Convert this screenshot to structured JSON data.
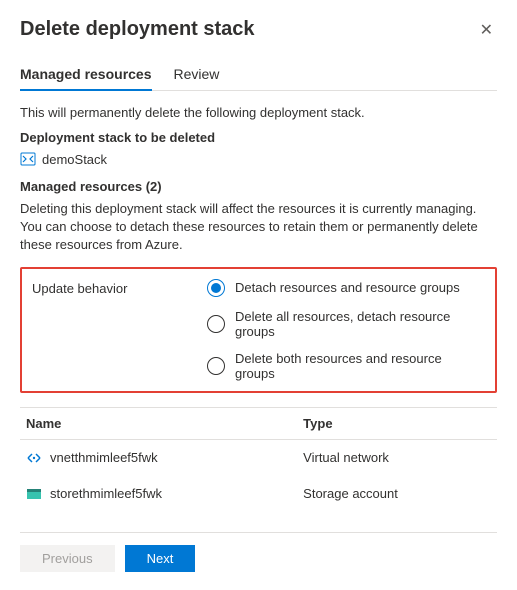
{
  "header": {
    "title": "Delete deployment stack"
  },
  "tabs": [
    {
      "label": "Managed resources",
      "active": true
    },
    {
      "label": "Review",
      "active": false
    }
  ],
  "intro_text": "This will permanently delete the following deployment stack.",
  "stack_section_label": "Deployment stack to be deleted",
  "stack_name": "demoStack",
  "managed_label": "Managed resources (2)",
  "managed_info": "Deleting this deployment stack will affect the resources it is currently managing. You can choose to detach these resources to retain them or permanently delete these resources from Azure.",
  "update_behavior": {
    "label": "Update behavior",
    "options": [
      {
        "label": "Detach resources and resource groups",
        "selected": true
      },
      {
        "label": "Delete all resources, detach resource groups",
        "selected": false
      },
      {
        "label": "Delete both resources and resource groups",
        "selected": false
      }
    ]
  },
  "table": {
    "columns": [
      "Name",
      "Type"
    ],
    "rows": [
      {
        "icon": "vnet",
        "name": "vnetthmimleef5fwk",
        "type": "Virtual network"
      },
      {
        "icon": "storage",
        "name": "storethmimleef5fwk",
        "type": "Storage account"
      }
    ]
  },
  "footer": {
    "previous": "Previous",
    "next": "Next"
  }
}
